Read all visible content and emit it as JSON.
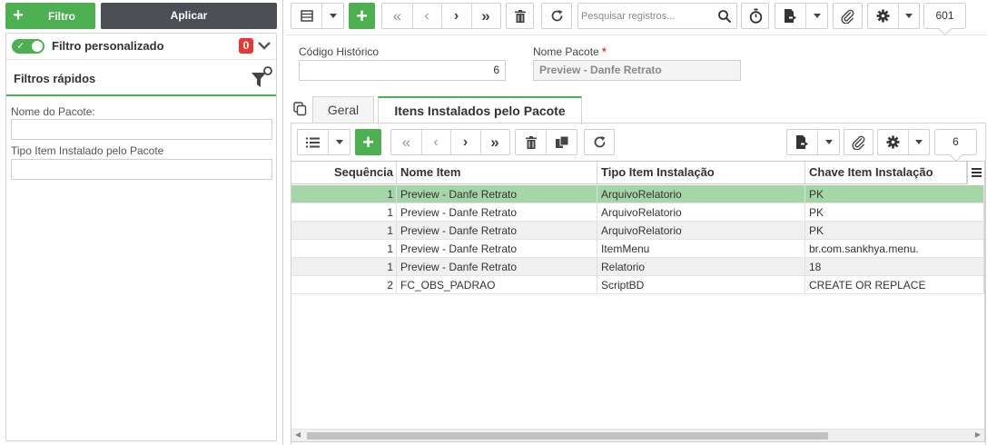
{
  "left_panel": {
    "filtro_label": "Filtro",
    "aplicar_label": "Aplicar",
    "custom_filter_label": "Filtro personalizado",
    "custom_filter_enabled": true,
    "custom_filter_count": "0",
    "quick_filters_title": "Filtros rápidos",
    "fields": [
      {
        "label": "Nome do Pacote:",
        "value": ""
      },
      {
        "label": "Tipo Item Instalado pelo Pacote",
        "value": ""
      }
    ]
  },
  "toolbar": {
    "search_placeholder": "Pesquisar registros...",
    "record_count": "601"
  },
  "form": {
    "codigo_label": "Código Histórico",
    "codigo_value": "6",
    "nome_label": "Nome Pacote",
    "nome_required": "*",
    "nome_value": "Preview - Danfe Retrato"
  },
  "tabs": [
    {
      "label": "Geral",
      "active": false
    },
    {
      "label": "Itens Instalados pelo Pacote",
      "active": true
    }
  ],
  "detail_toolbar": {
    "record_count": "6"
  },
  "grid": {
    "columns": [
      "Sequência",
      "Nome Item",
      "Tipo Item Instalação",
      "Chave Item Instalação"
    ],
    "rows": [
      [
        "1",
        "Preview - Danfe Retrato",
        "ArquivoRelatorio",
        "PK"
      ],
      [
        "1",
        "Preview - Danfe Retrato",
        "ArquivoRelatorio",
        "PK"
      ],
      [
        "1",
        "Preview - Danfe Retrato",
        "ArquivoRelatorio",
        "PK"
      ],
      [
        "1",
        "Preview - Danfe Retrato",
        "ItemMenu",
        "br.com.sankhya.menu."
      ],
      [
        "1",
        "Preview - Danfe Retrato",
        "Relatorio",
        "18"
      ],
      [
        "2",
        "FC_OBS_PADRAO",
        "ScriptBD",
        "CREATE OR REPLACE"
      ]
    ],
    "selected_row": 0
  },
  "colors": {
    "accent_green": "#4caf50",
    "selected_row": "#a5d6a7",
    "dark_button": "#4b4f55",
    "badge_red": "#e53935"
  }
}
